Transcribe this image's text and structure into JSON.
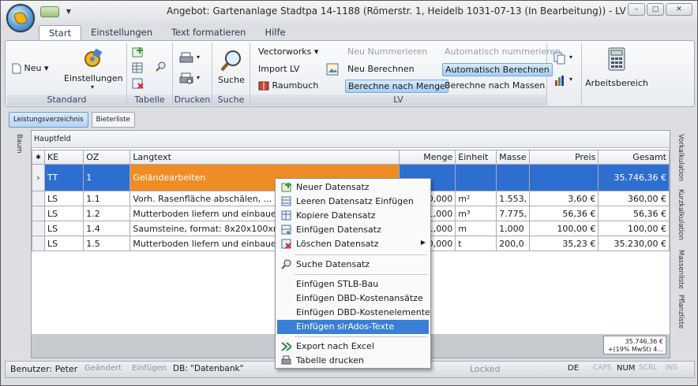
{
  "window": {
    "title": "Angebot: Gartenanlage Stadtpa 14-1188 (Römerstr. 1, Heidelb 1031-07-13 (In Bearbeitung)) - LV",
    "controls": [
      "–",
      "▢",
      "✕"
    ]
  },
  "ribbon_tabs": [
    "Start",
    "Einstellungen",
    "Text formatieren",
    "Hilfe"
  ],
  "ribbon": {
    "standard": {
      "label": "Standard",
      "neu": "Neu",
      "einstellungen": "Einstellungen"
    },
    "tabelle": {
      "label": "Tabelle"
    },
    "drucken": {
      "label": "Drucken"
    },
    "suche": {
      "label": "Suche",
      "button": "Suche"
    },
    "lv": {
      "label": "LV",
      "vectorworks": "Vectorworks",
      "import": "Import LV",
      "raumbuch": "Raumbuch",
      "neu_nummerieren": "Neu Nummerieren",
      "neu_berechnen": "Neu Berechnen",
      "berechne_menge": "Berechne nach Menge",
      "auto_nummerieren": "Automatisch nummerieren",
      "auto_berechnen": "Automatisch Berechnen",
      "berechne_massen": "Berechne nach Massen"
    },
    "arbeitsbereich": "Arbeitsbereich"
  },
  "subtabs": [
    "Leistungsverzeichnis",
    "Bieterliste"
  ],
  "left_sidebar": [
    "Baum"
  ],
  "right_sidebar": [
    "Vorkalkulation",
    "Kurzkalkulation",
    "Massenliste",
    "Pflanzliste"
  ],
  "panel_title": "Hauptfeld",
  "table": {
    "columns": [
      "",
      "KE",
      "OZ",
      "Langtext",
      "Menge",
      "Einheit",
      "Masse",
      "Preis",
      "Gesamt"
    ],
    "rows": [
      {
        "ke": "TT",
        "oz": "1",
        "text": "Geländearbeiten",
        "menge": "",
        "einheit": "",
        "masse": "",
        "preis": "",
        "gesamt": "35.746,36 €",
        "selected": true
      },
      {
        "ke": "LS",
        "oz": "1.1",
        "text": "Vorh. Rasenfläche abschälen, ...",
        "menge": "00,000",
        "einheit": "m²",
        "masse": "1.553,",
        "preis": "3,60 €",
        "gesamt": "360,00 €"
      },
      {
        "ke": "LS",
        "oz": "1.2",
        "text": "Mutterboden liefern und einbauen",
        "menge": "1,000",
        "einheit": "m³",
        "masse": "7.775,",
        "preis": "56,36 €",
        "gesamt": "56,36 €"
      },
      {
        "ke": "LS",
        "oz": "1.4",
        "text": "Saumsteine, format: 8x20x100xm,",
        "menge": "1,000",
        "einheit": "m",
        "masse": "1,000",
        "preis": "100,00 €",
        "gesamt": "100,00 €"
      },
      {
        "ke": "LS",
        "oz": "1.5",
        "text": "Mutterboden liefern und einbauen",
        "menge": "00,000",
        "einheit": "t",
        "masse": "200,0",
        "preis": "35,23 €",
        "gesamt": "35.230,00 €"
      }
    ],
    "total_line1": "35.746,36 €",
    "total_line2": "+(19% MwSt) 4..."
  },
  "context_menu": [
    {
      "label": "Neuer Datensatz",
      "icon": "plus-table-icon"
    },
    {
      "label": "Leeren Datensatz Einfügen",
      "icon": "table-insert-icon"
    },
    {
      "label": "Kopiere Datensatz",
      "icon": "copy-table-icon"
    },
    {
      "label": "Einfügen Datensatz",
      "icon": "paste-table-icon"
    },
    {
      "label": "Löschen Datensatz",
      "icon": "delete-table-icon",
      "submenu": true
    },
    {
      "label": "Suche Datensatz",
      "icon": "magnifier-icon"
    },
    {
      "label": "Einfügen STLB-Bau"
    },
    {
      "label": "Einfügen DBD-Kostenansätze"
    },
    {
      "label": "Einfügen DBD-Kostenelemente"
    },
    {
      "label": "Einfügen sirAdos-Texte",
      "hover": true
    },
    {
      "label": "Export nach Excel",
      "icon": "excel-icon"
    },
    {
      "label": "Tabelle drucken",
      "icon": "print-icon"
    }
  ],
  "statusbar": {
    "benutzer": "Benutzer: Peter",
    "geaendert": "Geändert",
    "einfuegen": "Einfügen",
    "db": "DB: \"Datenbank\"",
    "locked": "Locked",
    "lang": "DE",
    "caps": "CAPS",
    "num": "NUM",
    "scrl": "SCRL",
    "ins": "INS"
  }
}
